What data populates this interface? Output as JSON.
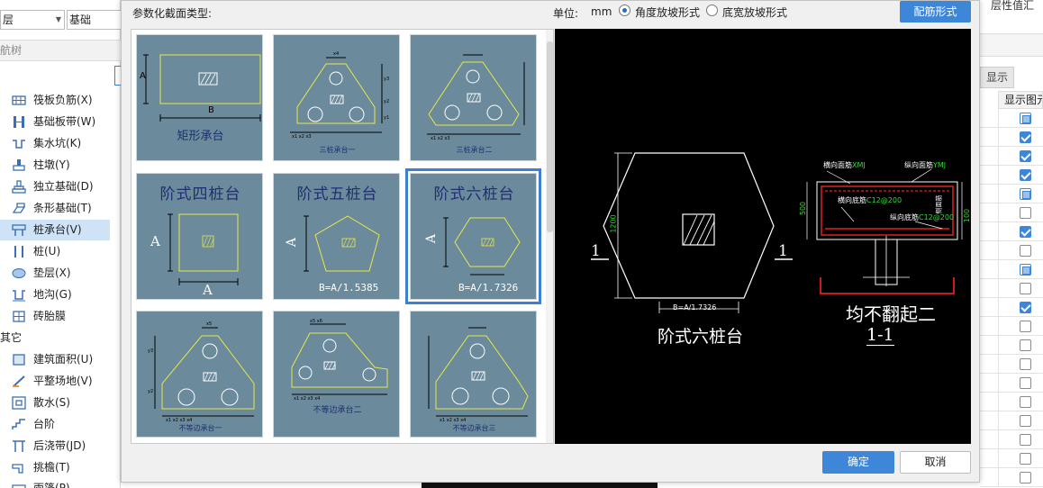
{
  "left_panel": {
    "floor_combo": "层",
    "category_combo": "基础",
    "tree_title": "航树",
    "items": [
      {
        "label": "筏板负筋(X)"
      },
      {
        "label": "基础板带(W)"
      },
      {
        "label": "集水坑(K)"
      },
      {
        "label": "柱墩(Y)"
      },
      {
        "label": "独立基础(D)"
      },
      {
        "label": "条形基础(T)"
      },
      {
        "label": "桩承台(V)"
      },
      {
        "label": "桩(U)"
      },
      {
        "label": "垫层(X)"
      },
      {
        "label": "地沟(G)"
      },
      {
        "label": "砖胎膜"
      }
    ],
    "group_other": "其它",
    "other_items": [
      {
        "label": "建筑面积(U)"
      },
      {
        "label": "平整场地(V)"
      },
      {
        "label": "散水(S)"
      },
      {
        "label": "台阶"
      },
      {
        "label": "后浇带(JD)"
      },
      {
        "label": "挑檐(T)"
      },
      {
        "label": "雨篷(P)"
      }
    ]
  },
  "right_panel": {
    "top_text": "层性值汇",
    "tab_show": "显示",
    "column_header": "显示图元",
    "checkbox_states": [
      "partial",
      "checked",
      "checked",
      "checked",
      "partial",
      "unchecked",
      "checked",
      "unchecked",
      "partial",
      "unchecked",
      "checked",
      "unchecked",
      "unchecked",
      "unchecked",
      "unchecked",
      "unchecked",
      "unchecked",
      "unchecked",
      "unchecked",
      "unchecked"
    ]
  },
  "dialog": {
    "type_label": "参数化截面类型:",
    "unit_label": "单位:",
    "unit_value": "mm",
    "radio_angle": "角度放坡形式",
    "radio_width": "底宽放坡形式",
    "radio_selected": "angle",
    "rebar_button": "配筋形式",
    "ok_button": "确定",
    "cancel_button": "取消",
    "thumbnails": [
      {
        "caption": "矩形承台",
        "label_a": "A",
        "label_b": "B"
      },
      {
        "caption": "三桩承台一"
      },
      {
        "caption": "三桩承台二"
      },
      {
        "caption": "阶式四桩台",
        "label_a": "A",
        "label_bottom": "A"
      },
      {
        "caption": "阶式五桩台",
        "label_a": "A",
        "formula": "B=A/1.5385"
      },
      {
        "caption": "阶式六桩台",
        "label_a": "A",
        "formula": "B=A/1.7326"
      },
      {
        "caption": "不等边承台一"
      },
      {
        "caption": "不等边承台二"
      },
      {
        "caption": "不等边承台三"
      }
    ],
    "selected_thumbnail": 5,
    "preview": {
      "section_mark_left": "1",
      "section_mark_right": "1",
      "dim_height": "1200",
      "dim_width": "B=A/1.7326",
      "plan_title": "阶式六桩台",
      "section_title": "均不翻起二",
      "section_name": "1-1",
      "rebar_top_h": "横向面筋",
      "rebar_top_h_code": "XMJ",
      "rebar_top_v": "纵向面筋",
      "rebar_top_v_code": "YMJ",
      "rebar_bot_h": "横向底筋",
      "rebar_bot_h_code": "C12@200",
      "rebar_bot_v": "纵向底筋",
      "rebar_bot_v_code": "C12@200",
      "side_rebar": "侧面筋",
      "dim_500": "500",
      "dim_100": "100",
      "green": "#36d936",
      "red": "#e02020"
    }
  }
}
